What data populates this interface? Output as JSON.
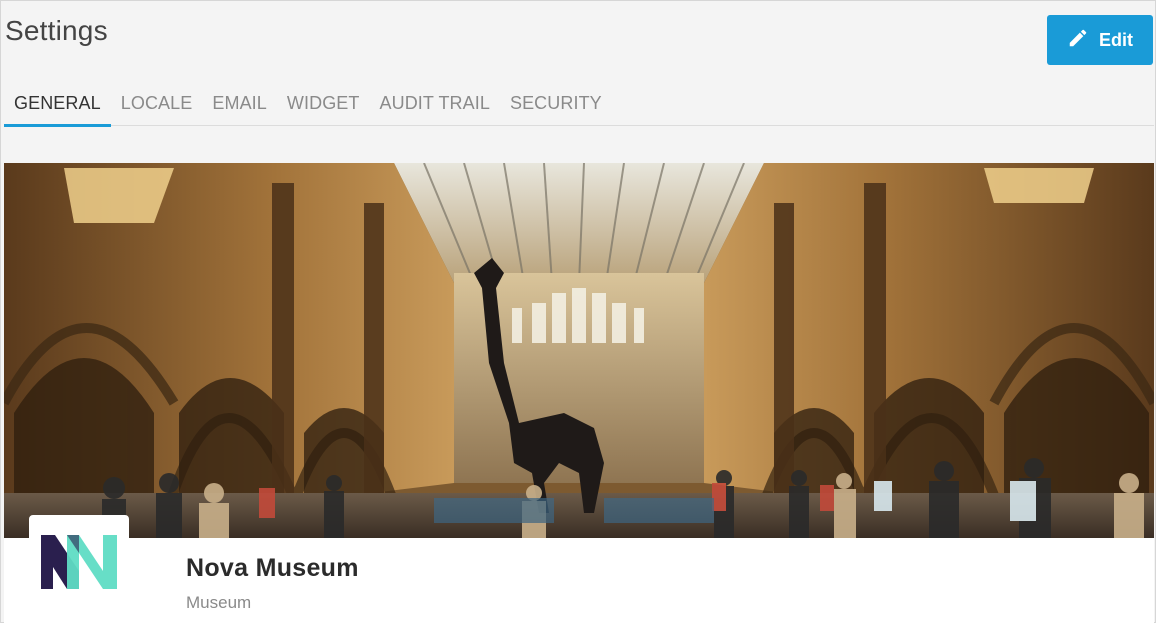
{
  "header": {
    "title": "Settings",
    "edit_label": "Edit"
  },
  "tabs": [
    {
      "label": "GENERAL",
      "active": true
    },
    {
      "label": "LOCALE",
      "active": false
    },
    {
      "label": "EMAIL",
      "active": false
    },
    {
      "label": "WIDGET",
      "active": false
    },
    {
      "label": "AUDIT TRAIL",
      "active": false
    },
    {
      "label": "SECURITY",
      "active": false
    }
  ],
  "profile": {
    "name": "Nova Museum",
    "type": "Museum"
  },
  "colors": {
    "accent": "#1a9bd7",
    "logo_dark": "#2a1f4e",
    "logo_teal": "#5fdcc4"
  },
  "icons": {
    "edit": "pencil-icon"
  }
}
